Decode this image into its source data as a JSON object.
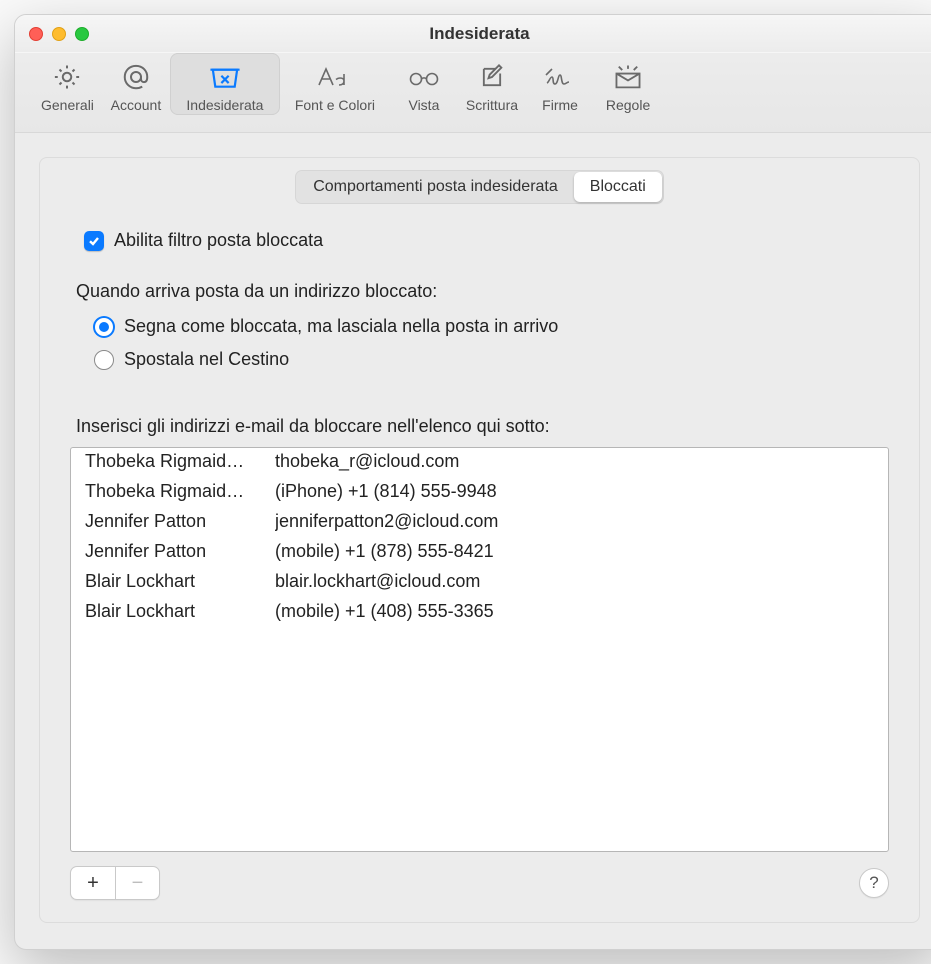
{
  "window": {
    "title": "Indesiderata"
  },
  "toolbar": {
    "items": [
      {
        "id": "generali",
        "label": "Generali"
      },
      {
        "id": "account",
        "label": "Account"
      },
      {
        "id": "indesiderata",
        "label": "Indesiderata"
      },
      {
        "id": "font",
        "label": "Font e Colori"
      },
      {
        "id": "vista",
        "label": "Vista"
      },
      {
        "id": "scrittura",
        "label": "Scrittura"
      },
      {
        "id": "firme",
        "label": "Firme"
      },
      {
        "id": "regole",
        "label": "Regole"
      }
    ],
    "selected": "indesiderata"
  },
  "segmented": {
    "options": [
      {
        "id": "comportamenti",
        "label": "Comportamenti posta indesiderata"
      },
      {
        "id": "bloccati",
        "label": "Bloccati"
      }
    ],
    "selected": "bloccati"
  },
  "enable_filter": {
    "checked": true,
    "label": "Abilita filtro posta bloccata"
  },
  "action_heading": "Quando arriva posta da un indirizzo bloccato:",
  "actions": {
    "selected": "mark",
    "mark": {
      "label": "Segna come bloccata, ma lasciala nella posta in arrivo"
    },
    "trash": {
      "label": "Spostala nel Cestino"
    }
  },
  "list_heading": "Inserisci gli indirizzi e-mail da bloccare nell'elenco qui sotto:",
  "blocked": [
    {
      "name": "Thobeka Rigmaid…",
      "detail": "thobeka_r@icloud.com"
    },
    {
      "name": "Thobeka Rigmaid…",
      "detail": "(iPhone) +1 (814) 555-9948"
    },
    {
      "name": "Jennifer Patton",
      "detail": "jenniferpatton2@icloud.com"
    },
    {
      "name": "Jennifer Patton",
      "detail": "(mobile) +1 (878) 555-8421"
    },
    {
      "name": "Blair Lockhart",
      "detail": "blair.lockhart@icloud.com"
    },
    {
      "name": "Blair Lockhart",
      "detail": "(mobile) +1 (408) 555-3365"
    }
  ],
  "footer": {
    "add": "+",
    "remove": "−",
    "help": "?"
  }
}
